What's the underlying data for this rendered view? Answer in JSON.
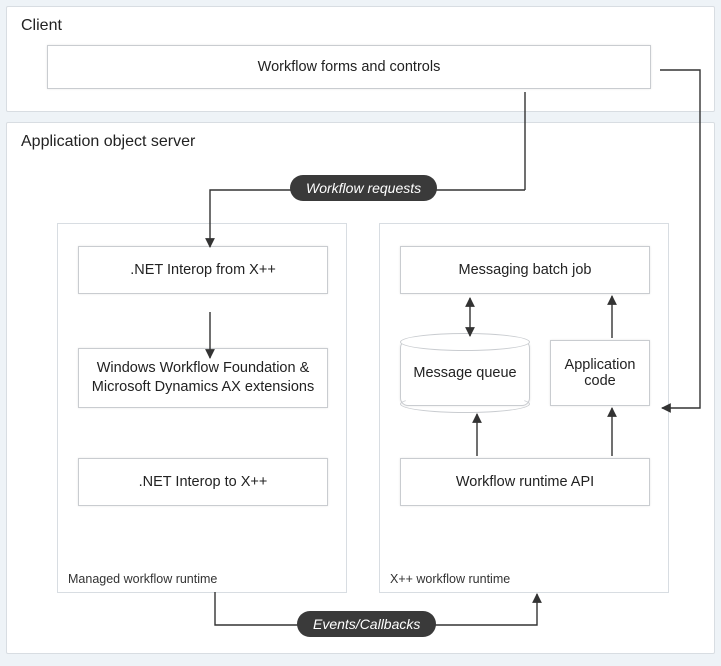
{
  "client": {
    "title": "Client",
    "forms_box": "Workflow forms and controls"
  },
  "aos": {
    "title": "Application object server",
    "workflow_requests_label": "Workflow requests",
    "events_callbacks_label": "Events/Callbacks",
    "managed": {
      "label": "Managed workflow runtime",
      "net_interop_from": ".NET Interop from X++",
      "wwf": "Windows Workflow Foundation & Microsoft Dynamics AX extensions",
      "net_interop_to": ".NET Interop to X++"
    },
    "xpp": {
      "label": "X++ workflow runtime",
      "messaging_batch": "Messaging batch job",
      "message_queue": "Message queue",
      "application_code": "Application code",
      "workflow_runtime_api": "Workflow runtime API"
    }
  },
  "chart_data": {
    "type": "diagram",
    "nodes": [
      {
        "id": "forms",
        "label": "Workflow forms and controls",
        "group": "Client"
      },
      {
        "id": "net_from",
        "label": ".NET Interop from X++",
        "group": "Managed workflow runtime"
      },
      {
        "id": "wwf",
        "label": "Windows Workflow Foundation & Microsoft Dynamics AX extensions",
        "group": "Managed workflow runtime"
      },
      {
        "id": "net_to",
        "label": ".NET Interop to X++",
        "group": "Managed workflow runtime"
      },
      {
        "id": "msg_batch",
        "label": "Messaging batch job",
        "group": "X++ workflow runtime"
      },
      {
        "id": "msg_queue",
        "label": "Message queue",
        "group": "X++ workflow runtime",
        "shape": "cylinder"
      },
      {
        "id": "app_code",
        "label": "Application code",
        "group": "X++ workflow runtime"
      },
      {
        "id": "wr_api",
        "label": "Workflow runtime API",
        "group": "X++ workflow runtime"
      }
    ],
    "groups": [
      {
        "id": "client",
        "label": "Client"
      },
      {
        "id": "aos",
        "label": "Application object server"
      },
      {
        "id": "managed",
        "label": "Managed workflow runtime",
        "parent": "aos"
      },
      {
        "id": "xpp",
        "label": "X++ workflow runtime",
        "parent": "aos"
      }
    ],
    "edges": [
      {
        "from": "forms",
        "to": "net_from",
        "label": "Workflow requests",
        "bidirectional": false
      },
      {
        "from": "forms",
        "to": "wr_api",
        "bidirectional": false
      },
      {
        "from": "wwf",
        "to": "net_to",
        "bidirectional": false
      },
      {
        "from": "msg_batch",
        "to": "msg_queue",
        "bidirectional": true
      },
      {
        "from": "app_code",
        "to": "msg_batch",
        "bidirectional": false
      },
      {
        "from": "wr_api",
        "to": "msg_queue",
        "bidirectional": false
      },
      {
        "from": "wr_api",
        "to": "app_code",
        "bidirectional": false
      },
      {
        "from": "managed",
        "to": "xpp",
        "label": "Events/Callbacks",
        "bidirectional": false
      }
    ]
  }
}
